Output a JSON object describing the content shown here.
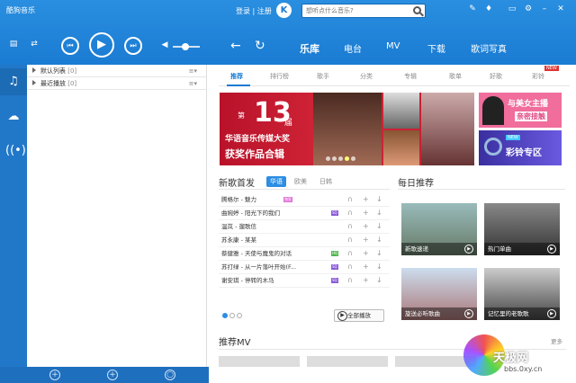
{
  "app": {
    "title": "酷狗音乐"
  },
  "header": {
    "login": "登录 | 注册",
    "logo": "K",
    "search_placeholder": "想听点什么音乐?"
  },
  "nav": {
    "tabs": [
      "乐库",
      "电台",
      "MV",
      "下载",
      "歌词写真"
    ],
    "active": "乐库"
  },
  "playlists": [
    {
      "name": "默认列表",
      "count": "[0]"
    },
    {
      "name": "最近播放",
      "count": "[0]"
    }
  ],
  "subtabs": [
    "推荐",
    "排行榜",
    "歌手",
    "分类",
    "专辑",
    "歌单",
    "好歌",
    "彩铃"
  ],
  "subtab_new": "NEW",
  "banner": {
    "di": "第",
    "num": "13",
    "jie": "届",
    "line1": "华语音乐传媒大奖",
    "line2": "获奖作品合辑"
  },
  "promo1": {
    "line1": "与美女主播",
    "line2": "亲密接触"
  },
  "promo2": {
    "badge": "NEW",
    "text": "彩铃专区"
  },
  "new_songs": {
    "title": "新歌首发",
    "filters": [
      "华语",
      "欧美",
      "日韩"
    ],
    "songs": [
      {
        "title": "腾格尔 - 魅力",
        "tag": "独家",
        "tagcolor": "#e070d8"
      },
      {
        "title": "曲婉婷 - 阳光下的我们",
        "tag": "SQ",
        "tagcolor": "#8a5ad8"
      },
      {
        "title": "温岚 - 遛歌信",
        "tag": "",
        "tagcolor": ""
      },
      {
        "title": "苏永康 - 某某",
        "tag": "",
        "tagcolor": ""
      },
      {
        "title": "蔡健雅 - 天使与魔鬼的对话",
        "tag": "HQ",
        "tagcolor": "#4fb84f"
      },
      {
        "title": "苏打绿 - 从一片落叶开始(F...",
        "tag": "SQ",
        "tagcolor": "#8a5ad8"
      },
      {
        "title": "谢安琪 - 停转的木马",
        "tag": "SQ",
        "tagcolor": "#8a5ad8"
      }
    ],
    "play_all": "全部播放"
  },
  "daily": {
    "title": "每日推荐",
    "items": [
      "新歌速递",
      "热门单曲",
      "旋送必听歌曲",
      "记忆里的老歌歌"
    ]
  },
  "mv": {
    "title": "推荐MV",
    "more": "更多"
  },
  "watermark": {
    "logo": "天极网",
    "url": "bbs.0xy.cn"
  }
}
